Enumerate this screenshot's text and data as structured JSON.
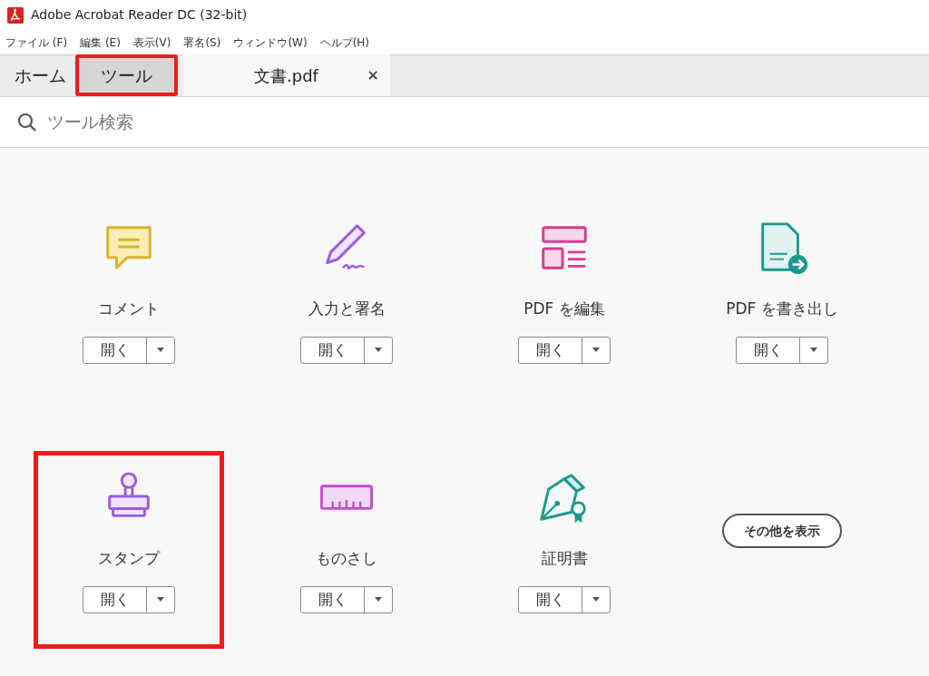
{
  "window": {
    "title": "Adobe Acrobat Reader DC (32-bit)"
  },
  "menu": [
    "ファイル (F)",
    "編集 (E)",
    "表示(V)",
    "署名(S)",
    "ウィンドウ(W)",
    "ヘルプ(H)"
  ],
  "tabs": [
    {
      "label": "ホーム",
      "selected": false,
      "highlighted": false
    },
    {
      "label": "ツール",
      "selected": true,
      "highlighted": true
    }
  ],
  "document_tab": {
    "label": "文書.pdf",
    "close": "×"
  },
  "search": {
    "placeholder": "ツール検索"
  },
  "tools": [
    {
      "kind": "tool",
      "label": "コメント",
      "open": "開く",
      "highlighted": false
    },
    {
      "kind": "tool",
      "label": "入力と署名",
      "open": "開く",
      "highlighted": false
    },
    {
      "kind": "tool",
      "label": "PDF を編集",
      "open": "開く",
      "highlighted": false
    },
    {
      "kind": "tool",
      "label": "PDF を書き出し",
      "open": "開く",
      "highlighted": false
    },
    {
      "kind": "tool",
      "label": "スタンプ",
      "open": "開く",
      "highlighted": true
    },
    {
      "kind": "tool",
      "label": "ものさし",
      "open": "開く",
      "highlighted": false
    },
    {
      "kind": "tool",
      "label": "証明書",
      "open": "開く",
      "highlighted": false
    },
    {
      "kind": "more",
      "label": "その他を表示"
    }
  ]
}
